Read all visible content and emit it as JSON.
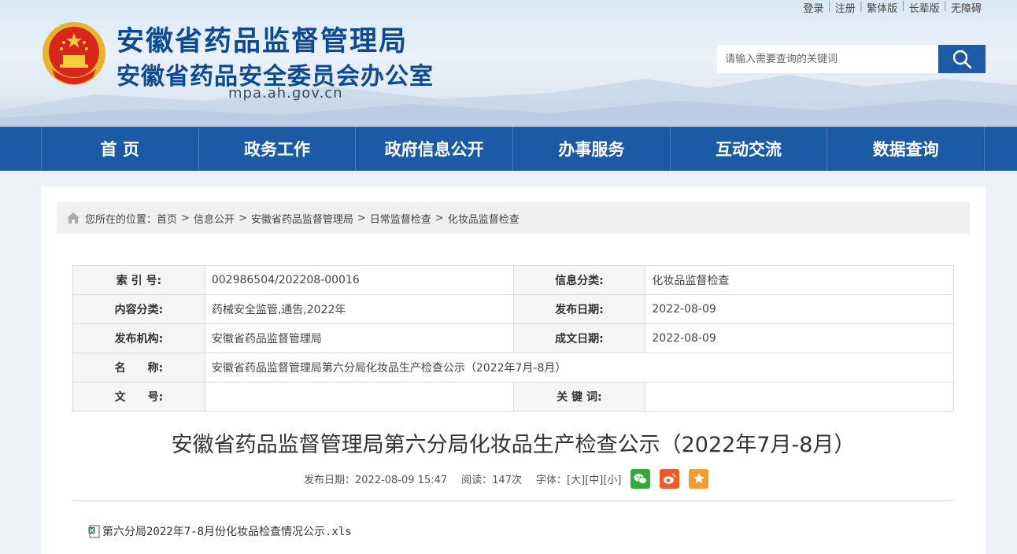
{
  "toplinks": [
    "登录",
    "注册",
    "繁体版",
    "长辈版",
    "无障碍"
  ],
  "site": {
    "title1": "安徽省药品监督管理局",
    "title2": "安徽省药品安全委员会办公室",
    "domain": "mpa.ah.gov.cn"
  },
  "search": {
    "placeholder": "请输入需要查询的关键词"
  },
  "nav": [
    "首 页",
    "政务工作",
    "政府信息公开",
    "办事服务",
    "互动交流",
    "数据查询"
  ],
  "breadcrumb": {
    "prefix": "您所在的位置：",
    "items": [
      "首页",
      "信息公开",
      "安徽省药品监督管理局",
      "日常监督检查",
      "化妆品监督检查"
    ]
  },
  "meta": {
    "index_label": "索 引 号:",
    "index_value": "002986504/202208-00016",
    "category_label": "信息分类:",
    "category_value": "化妆品监督检查",
    "content_label": "内容分类:",
    "content_value": "药械安全监管,通告,2022年",
    "pubdate_label": "发布日期:",
    "pubdate_value": "2022-08-09",
    "org_label": "发布机构:",
    "org_value": "安徽省药品监督管理局",
    "createdate_label": "成文日期:",
    "createdate_value": "2022-08-09",
    "name_label": "名　　称:",
    "name_value": "安徽省药品监督管理局第六分局化妆品生产检查公示（2022年7月-8月）",
    "docno_label": "文　　号:",
    "docno_value": "",
    "keywords_label": "关 键 词:",
    "keywords_value": ""
  },
  "article": {
    "title": "安徽省药品监督管理局第六分局化妆品生产检查公示（2022年7月-8月）",
    "pub_time": "发布日期：2022-08-09 15:47",
    "reads": "阅读：147次",
    "font_label": "字体：",
    "font_large": "[大]",
    "font_medium": "[中]",
    "font_small": "[小]",
    "attachment": "第六分局2022年7-8月份化妆品检查情况公示.xls"
  },
  "colors": {
    "brand": "#1b5aa5",
    "title": "#0e4a94",
    "wechat": "#2bad37",
    "weibo": "#ef5a28",
    "favorite": "#f59d2a"
  }
}
